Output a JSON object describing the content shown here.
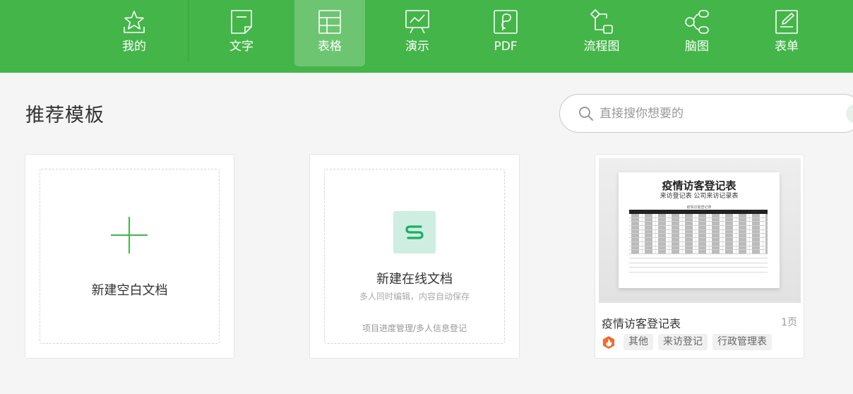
{
  "nav": {
    "items": [
      {
        "label": "我的",
        "icon": "star-icon"
      },
      {
        "label": "文字",
        "icon": "document-icon"
      },
      {
        "label": "表格",
        "icon": "spreadsheet-icon"
      },
      {
        "label": "演示",
        "icon": "presentation-icon"
      },
      {
        "label": "PDF",
        "icon": "pdf-icon"
      },
      {
        "label": "流程图",
        "icon": "flowchart-icon"
      },
      {
        "label": "脑图",
        "icon": "mindmap-icon"
      },
      {
        "label": "表单",
        "icon": "form-icon"
      }
    ],
    "active_index": 2
  },
  "section": {
    "title": "推荐模板"
  },
  "search": {
    "placeholder": "直接搜你想要的",
    "icon": "search-icon"
  },
  "cards": {
    "blank": {
      "title": "新建空白文档",
      "icon": "plus-icon"
    },
    "online": {
      "title": "新建在线文档",
      "subtitle": "多人同时编辑，内容自动保存",
      "hint": "项目进度管理/多人信息登记",
      "icon": "s-logo-icon"
    },
    "template": {
      "name": "疫情访客登记表",
      "pages": "1页",
      "preview_title": "疫情访客登记表",
      "preview_subtitle": "来访登记表 公司来访记录表",
      "preview_caption": "疫情访客登记表",
      "tags": [
        "其他",
        "来访登记",
        "行政管理表"
      ]
    }
  },
  "colors": {
    "brand": "#44b549",
    "nav_active": "#6cc770",
    "logo_bg": "#cdeee0",
    "hot_badge": "#f26b2d"
  }
}
